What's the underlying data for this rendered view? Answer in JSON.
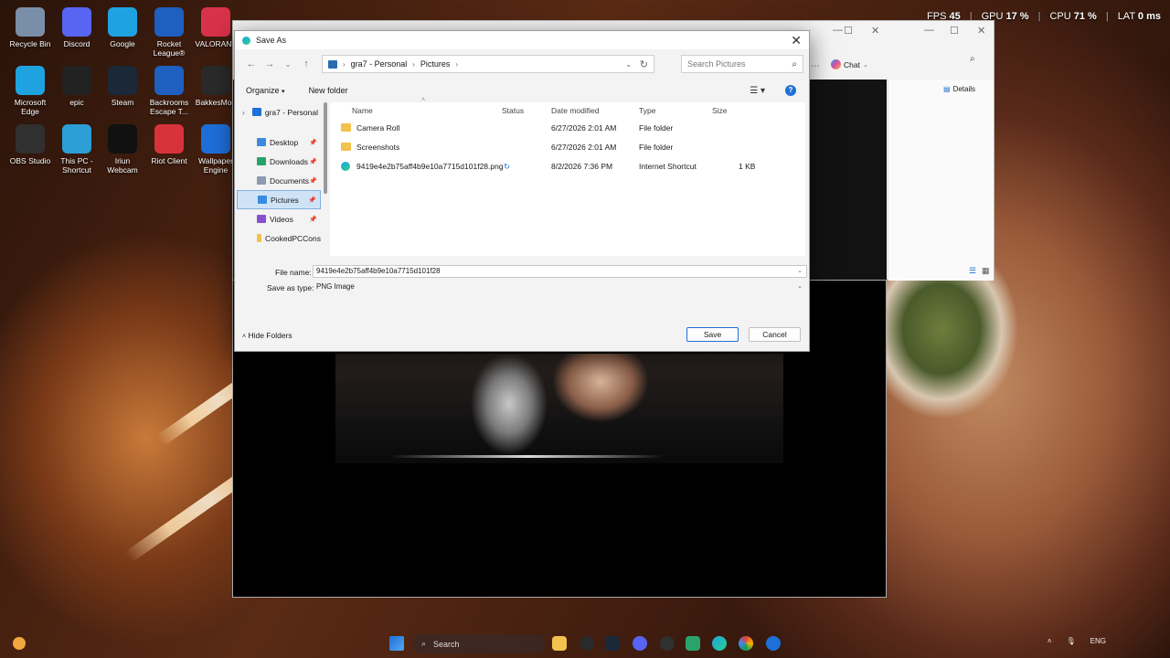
{
  "desktop": {
    "icons": [
      {
        "label": "Recycle Bin",
        "icon": "recycle-bin-icon",
        "color": "#7a8ea8"
      },
      {
        "label": "Discord",
        "icon": "discord-icon",
        "color": "#5865f2"
      },
      {
        "label": "Google",
        "icon": "edge-icon",
        "color": "#1fa3e0"
      },
      {
        "label": "Rocket League®",
        "icon": "rocket-league-icon",
        "color": "#1f5fbf"
      },
      {
        "label": "VALORANT",
        "icon": "valorant-icon",
        "color": "#d8324a"
      },
      {
        "label": "Microsoft Edge",
        "icon": "edge-icon",
        "color": "#1fa3e0"
      },
      {
        "label": "epic",
        "icon": "epic-games-icon",
        "color": "#222222"
      },
      {
        "label": "Steam",
        "icon": "steam-icon",
        "color": "#1b2838"
      },
      {
        "label": "Backrooms Escape T...",
        "icon": "backrooms-icon",
        "color": "#1e5fbf"
      },
      {
        "label": "BakkesMod",
        "icon": "bakkesmod-icon",
        "color": "#2a2a2a"
      },
      {
        "label": "OBS Studio",
        "icon": "obs-icon",
        "color": "#303030"
      },
      {
        "label": "This PC - Shortcut",
        "icon": "this-pc-icon",
        "color": "#2b9fd6"
      },
      {
        "label": "Iriun Webcam",
        "icon": "webcam-icon",
        "color": "#111111"
      },
      {
        "label": "Riot Client",
        "icon": "riot-icon",
        "color": "#d8323a"
      },
      {
        "label": "Wallpaper Engine",
        "icon": "wallpaper-engine-icon",
        "color": "#1e6fd9"
      }
    ]
  },
  "hud": {
    "fps_label": "FPS",
    "fps": "45",
    "gpu_label": "GPU",
    "gpu": "17 %",
    "cpu_label": "CPU",
    "cpu": "71 %",
    "lat_label": "LAT",
    "lat": "0 ms"
  },
  "bg_window": {
    "chat_label": "Chat",
    "details_label": "Details"
  },
  "dialog": {
    "title": "Save As",
    "breadcrumb": [
      "gra7 - Personal",
      "Pictures"
    ],
    "search_placeholder": "Search Pictures",
    "organize_label": "Organize",
    "new_folder_label": "New folder",
    "nav": [
      {
        "label": "gra7 - Personal",
        "icon": "cloud-icon",
        "color": "#1e6fd9"
      },
      {
        "label": "Desktop",
        "icon": "desktop-icon",
        "color": "#3a8be0"
      },
      {
        "label": "Downloads",
        "icon": "download-icon",
        "color": "#2aa36b"
      },
      {
        "label": "Documents",
        "icon": "document-icon",
        "color": "#8a9bb0"
      },
      {
        "label": "Pictures",
        "icon": "pictures-icon",
        "color": "#3a8be0"
      },
      {
        "label": "Videos",
        "icon": "video-icon",
        "color": "#8a4fd0"
      },
      {
        "label": "CookedPCCons",
        "icon": "folder-icon",
        "color": "#f2c14e"
      }
    ],
    "columns": {
      "name": "Name",
      "status": "Status",
      "date": "Date modified",
      "type": "Type",
      "size": "Size"
    },
    "files": [
      {
        "name": "Camera Roll",
        "status": "",
        "date": "6/27/2026 2:01 AM",
        "type": "File folder",
        "size": "",
        "kind": "folder"
      },
      {
        "name": "Screenshots",
        "status": "",
        "date": "6/27/2026 2:01 AM",
        "type": "File folder",
        "size": "",
        "kind": "folder"
      },
      {
        "name": "9419e4e2b75aff4b9e10a7715d101f28.png",
        "status": "sync",
        "date": "8/2/2026 7:36 PM",
        "type": "Internet Shortcut",
        "size": "1 KB",
        "kind": "shortcut"
      }
    ],
    "file_name_label": "File name:",
    "file_name_value": "9419e4e2b75aff4b9e10a7715d101f28",
    "save_type_label": "Save as type:",
    "save_type_value": "PNG Image",
    "hide_folders_label": "Hide Folders",
    "save_label": "Save",
    "cancel_label": "Cancel"
  },
  "taskbar": {
    "search_label": "Search",
    "language": "ENG"
  }
}
